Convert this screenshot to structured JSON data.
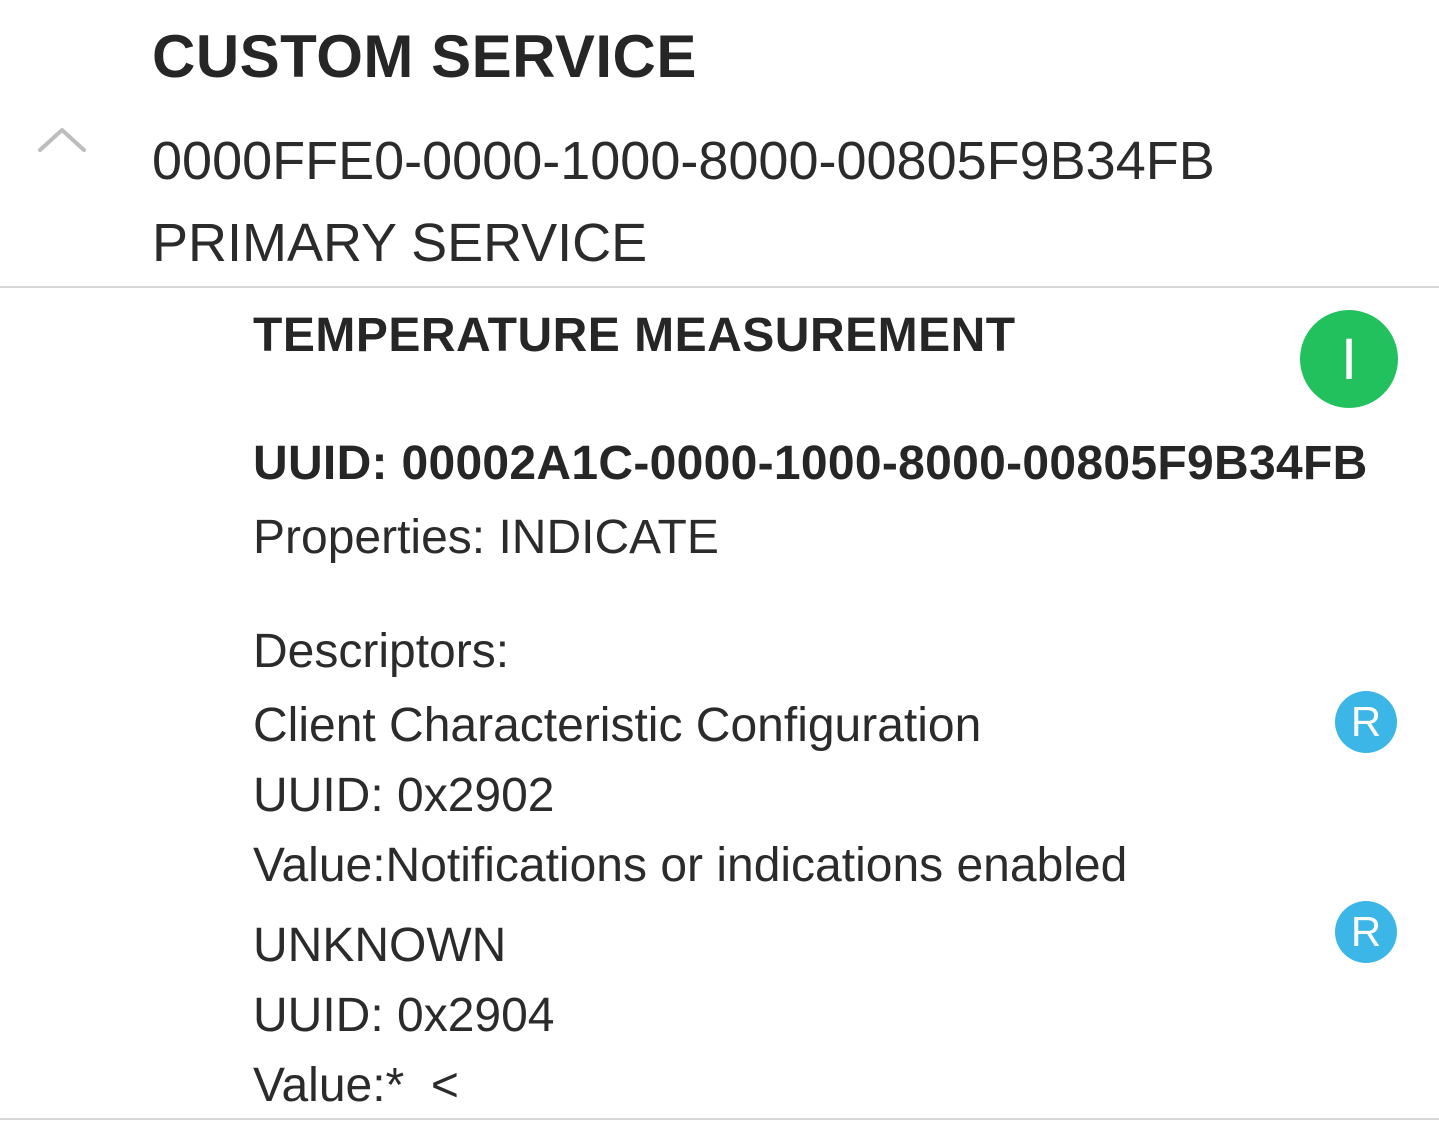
{
  "service": {
    "name": "CUSTOM SERVICE",
    "uuid": "0000FFE0-0000-1000-8000-00805F9B34FB",
    "type": "PRIMARY SERVICE",
    "collapse_icon": "chevron-up-icon"
  },
  "characteristic": {
    "name": "TEMPERATURE MEASUREMENT",
    "uuid_line": "UUID: 00002A1C-0000-1000-8000-00805F9B34FB",
    "properties_line": "Properties: INDICATE",
    "indicate_badge": "I",
    "indicate_badge_color": "#22c15e",
    "descriptors_header": "Descriptors:",
    "descriptors": [
      {
        "name": "Client Characteristic Configuration",
        "uuid_line": "UUID: 0x2902",
        "value_line": "Value:Notifications or indications enabled",
        "read_badge": "R"
      },
      {
        "name": "UNKNOWN",
        "uuid_line": "UUID: 0x2904",
        "value_line": "Value:*  <",
        "read_badge": "R"
      }
    ],
    "read_badge_color": "#3bb6e6"
  }
}
